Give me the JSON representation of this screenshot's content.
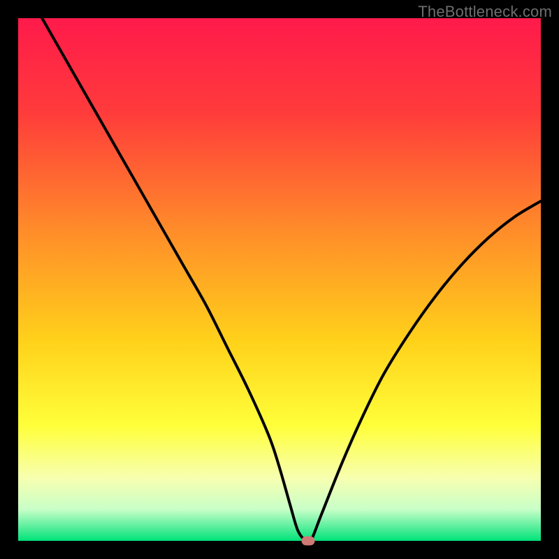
{
  "watermark": "TheBottleneck.com",
  "chart_data": {
    "type": "line",
    "title": "",
    "xlabel": "",
    "ylabel": "",
    "xlim": [
      0,
      100
    ],
    "ylim": [
      0,
      100
    ],
    "gradient_stops": [
      {
        "pct": 0,
        "color": "#ff1a4b"
      },
      {
        "pct": 18,
        "color": "#ff3b3b"
      },
      {
        "pct": 40,
        "color": "#ff8a2a"
      },
      {
        "pct": 62,
        "color": "#ffd21a"
      },
      {
        "pct": 78,
        "color": "#ffff3a"
      },
      {
        "pct": 88,
        "color": "#f7ffb0"
      },
      {
        "pct": 94,
        "color": "#c8ffc8"
      },
      {
        "pct": 100,
        "color": "#00e27a"
      }
    ],
    "series": [
      {
        "name": "bottleneck-curve",
        "x": [
          0,
          4,
          8,
          12,
          16,
          20,
          24,
          28,
          32,
          36,
          40,
          44,
          48,
          50,
          52,
          53.5,
          55,
          56,
          58,
          62,
          66,
          70,
          75,
          80,
          85,
          90,
          95,
          100
        ],
        "y": [
          108,
          101,
          94,
          87,
          80,
          73,
          66,
          59,
          52,
          45,
          37,
          29,
          20,
          14,
          7,
          2,
          0,
          0,
          5,
          15,
          24,
          32,
          40,
          47,
          53,
          58,
          62,
          65
        ]
      }
    ],
    "marker": {
      "x": 55.5,
      "y": 0,
      "color": "#cf7a74"
    },
    "curve_color": "#000000",
    "curve_width": 4
  }
}
